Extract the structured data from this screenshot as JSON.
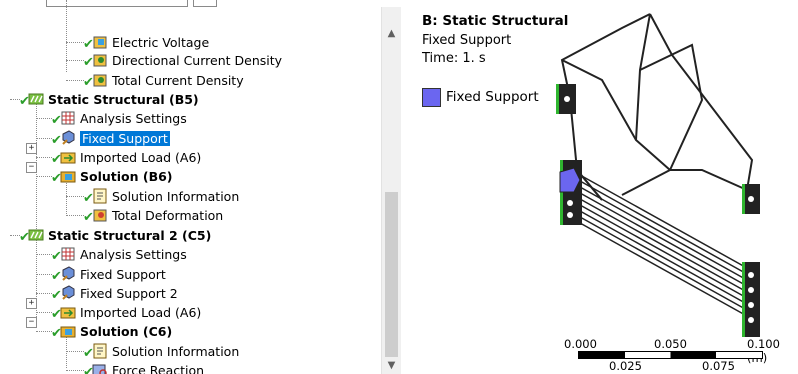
{
  "tree": {
    "rows": [
      {
        "label": "Electric Voltage",
        "bold": false,
        "selected": false
      },
      {
        "label": "Directional Current Density",
        "bold": false,
        "selected": false
      },
      {
        "label": "Total Current Density",
        "bold": false,
        "selected": false
      },
      {
        "label": "Static Structural (B5)",
        "bold": true,
        "selected": false
      },
      {
        "label": "Analysis Settings",
        "bold": false,
        "selected": false
      },
      {
        "label": "Fixed Support",
        "bold": false,
        "selected": true
      },
      {
        "label": "Imported Load (A6)",
        "bold": false,
        "selected": false
      },
      {
        "label": "Solution (B6)",
        "bold": true,
        "selected": false
      },
      {
        "label": "Solution Information",
        "bold": false,
        "selected": false
      },
      {
        "label": "Total Deformation",
        "bold": false,
        "selected": false
      },
      {
        "label": "Static Structural 2 (C5)",
        "bold": true,
        "selected": false
      },
      {
        "label": "Analysis Settings",
        "bold": false,
        "selected": false
      },
      {
        "label": "Fixed Support",
        "bold": false,
        "selected": false
      },
      {
        "label": "Fixed Support 2",
        "bold": false,
        "selected": false
      },
      {
        "label": "Imported Load (A6)",
        "bold": false,
        "selected": false
      },
      {
        "label": "Solution (C6)",
        "bold": true,
        "selected": false
      },
      {
        "label": "Solution Information",
        "bold": false,
        "selected": false
      },
      {
        "label": "Force Reaction",
        "bold": false,
        "selected": false
      }
    ],
    "icons": [
      "voltage-result-icon",
      "current-density-result-icon",
      "current-density-result-icon",
      "static-structural-icon",
      "analysis-settings-icon",
      "fixed-support-icon",
      "imported-load-icon",
      "solution-icon",
      "solution-information-icon",
      "total-deformation-icon",
      "static-structural-icon",
      "analysis-settings-icon",
      "fixed-support-icon",
      "fixed-support-icon",
      "imported-load-icon",
      "solution-icon",
      "solution-information-icon",
      "force-reaction-icon"
    ],
    "expanders": {
      "imported_load_b": "+",
      "solution_b": "−",
      "imported_load_c": "+",
      "solution_c": "−"
    },
    "scroll_up": "▲",
    "scroll_down": "▼"
  },
  "view": {
    "title": "B: Static Structural",
    "subtitle": "Fixed Support",
    "time": "Time: 1. s",
    "legend_label": "Fixed Support",
    "legend_color": "#6b66f0",
    "scale": {
      "top_labels": [
        "0.000",
        "0.050",
        "0.100 (m)"
      ],
      "bottom_labels": [
        "0.025",
        "0.075"
      ]
    }
  },
  "colors": {
    "selection": "#0078d7",
    "check": "#2a9d2a",
    "support": "#6b66f0",
    "edge_green": "#2fb52f"
  }
}
